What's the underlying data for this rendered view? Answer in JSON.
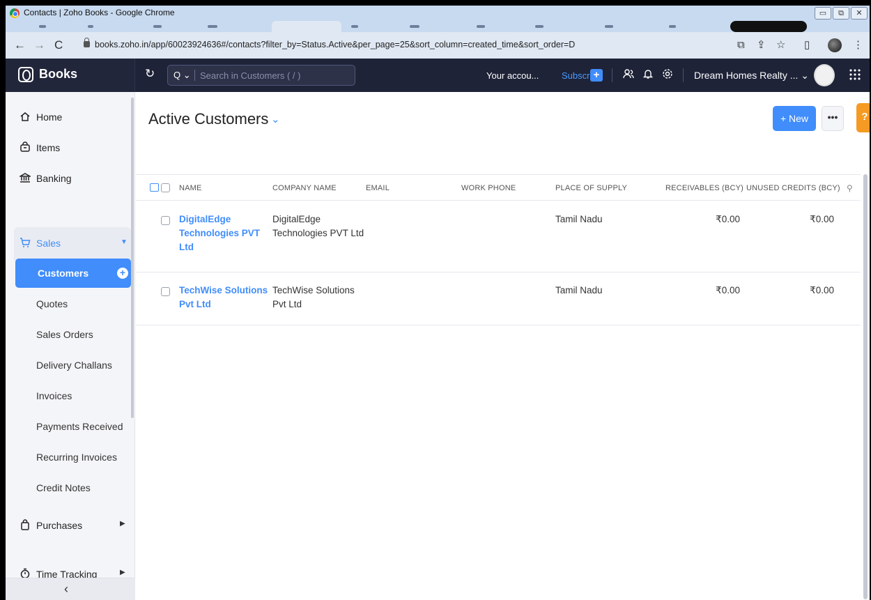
{
  "window": {
    "title": "Contacts | Zoho Books - Google Chrome",
    "controls": [
      "▭",
      "⧉",
      "✕"
    ]
  },
  "browser": {
    "url": "books.zoho.in/app/60023924636#/contacts?filter_by=Status.Active&per_page=25&sort_column=created_time&sort_order=D",
    "back": "←",
    "forward": "→",
    "reload": "C",
    "right_icons": [
      "⧉",
      "⇪",
      "☆",
      "▯",
      "⋮"
    ]
  },
  "app": {
    "brand": "Books",
    "refresh_icon": "↻",
    "search_placeholder": "Search in Customers ( / )",
    "search_scope": "Q ⌄",
    "your_account": "Your accou...",
    "subscribe": "Subscribe",
    "plus": "+",
    "org_name": "Dream Homes Realty ... ⌄"
  },
  "sidebar": {
    "home": "Home",
    "items": "Items",
    "banking": "Banking",
    "sales": "Sales",
    "sub_items": [
      "Customers",
      "Quotes",
      "Sales Orders",
      "Delivery Challans",
      "Invoices",
      "Payments Received",
      "Recurring Invoices",
      "Credit Notes"
    ],
    "purchases": "Purchases",
    "time_tracking": "Time Tracking",
    "collapse": "‹"
  },
  "main": {
    "title": "Active Customers",
    "new_button": "+ New",
    "more_button": "•••",
    "help_button": "?",
    "columns": [
      "NAME",
      "COMPANY NAME",
      "EMAIL",
      "WORK PHONE",
      "PLACE OF SUPPLY",
      "RECEIVABLES (BCY)",
      "UNUSED CREDITS (BCY)"
    ],
    "rows": [
      {
        "name_lines": [
          "DigitalEdge",
          "Technologies PVT",
          "Ltd"
        ],
        "company_lines": [
          "DigitalEdge",
          "Technologies PVT Ltd"
        ],
        "email": "",
        "work_phone": "",
        "place_of_supply": "Tamil Nadu",
        "receivables": "₹0.00",
        "unused_credits": "₹0.00"
      },
      {
        "name_lines": [
          "TechWise Solutions",
          "Pvt Ltd"
        ],
        "company_lines": [
          "TechWise Solutions",
          "Pvt Ltd"
        ],
        "email": "",
        "work_phone": "",
        "place_of_supply": "Tamil Nadu",
        "receivables": "₹0.00",
        "unused_credits": "₹0.00"
      }
    ]
  },
  "colors": {
    "accent": "#408dfb",
    "header_bg": "#1e2338",
    "help_orange": "#f59a23"
  }
}
